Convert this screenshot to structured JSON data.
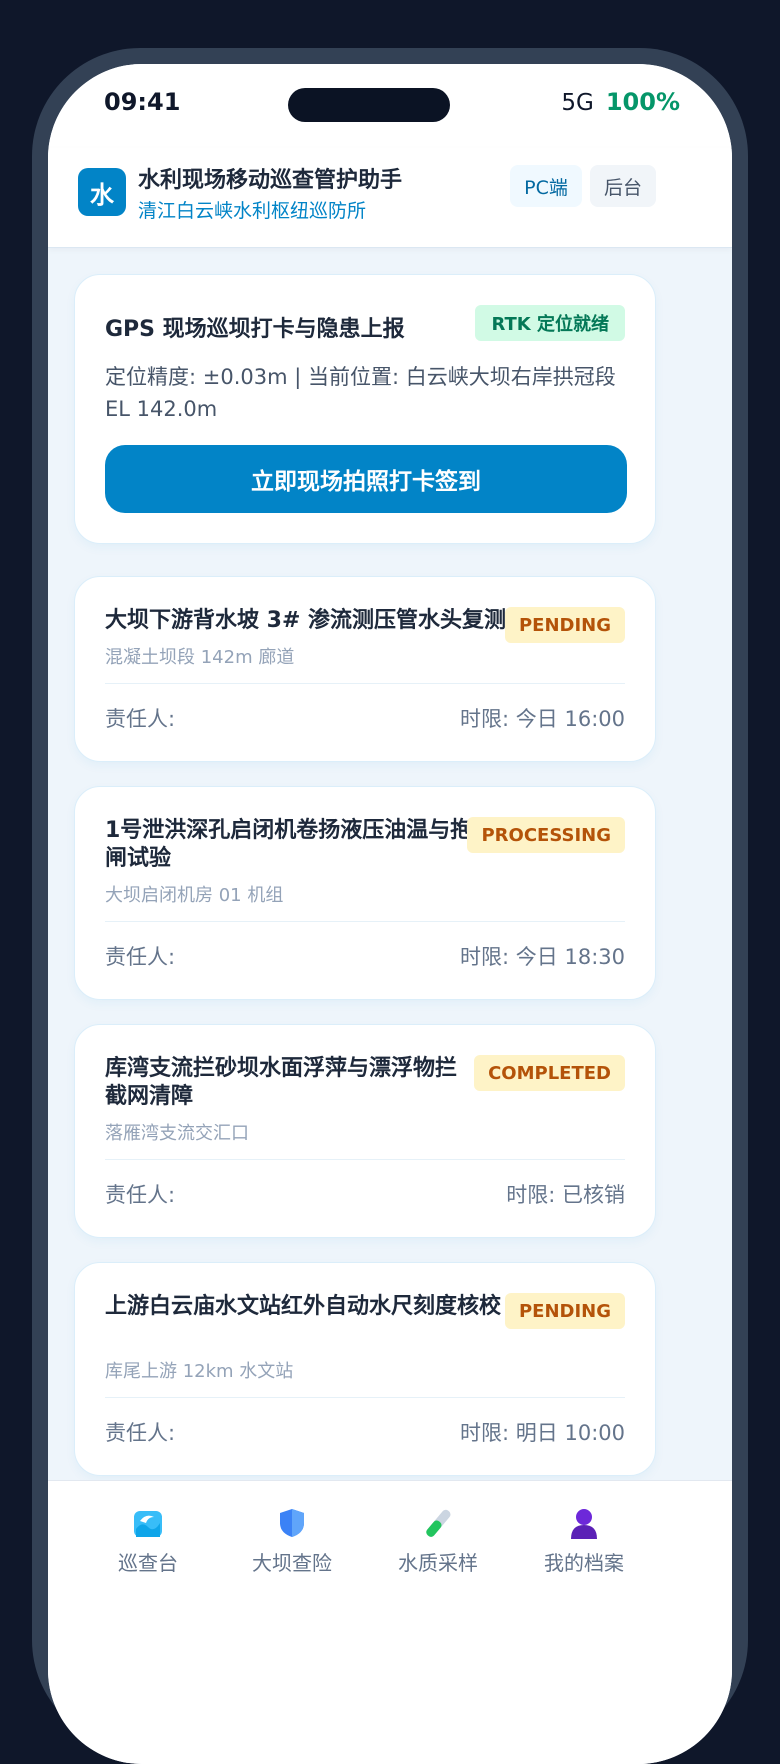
{
  "status_bar": {
    "time": "09:41",
    "signal": "5G",
    "battery": "100%"
  },
  "header": {
    "logo_char": "水",
    "title": "水利现场移动巡查管护助手",
    "subtitle": "清江白云峡水利枢纽巡防所",
    "btn_pc": "PC端",
    "btn_admin": "后台"
  },
  "gps_card": {
    "title": "GPS 现场巡坝打卡与隐患上报",
    "badge": "RTK 定位就绪",
    "description": "定位精度: ±0.03m | 当前位置: 白云峡大坝右岸拱冠段 EL 142.0m",
    "button_label": "立即现场拍照打卡签到"
  },
  "tasks": [
    {
      "title": "大坝下游背水坡 3# 渗流测压管水头复测",
      "location": "混凝土坝段 142m 廊道",
      "status": "PENDING",
      "owner": "责任人:",
      "deadline": "时限: 今日 16:00"
    },
    {
      "title": "1号泄洪深孔启闭机卷扬液压油温与抱闸试验",
      "location": "大坝启闭机房 01 机组",
      "status": "PROCESSING",
      "owner": "责任人:",
      "deadline": "时限: 今日 18:30"
    },
    {
      "title": "库湾支流拦砂坝水面浮萍与漂浮物拦截网清障",
      "location": "落雁湾支流交汇口",
      "status": "COMPLETED",
      "owner": "责任人:",
      "deadline": "时限: 已核销"
    },
    {
      "title": "上游白云庙水文站红外自动水尺刻度核校",
      "location": "库尾上游 12km 水文站",
      "status": "PENDING",
      "owner": "责任人:",
      "deadline": "时限: 明日 10:00"
    }
  ],
  "nav": [
    {
      "label": "巡查台",
      "icon": "wave-icon"
    },
    {
      "label": "大坝查险",
      "icon": "shield-icon"
    },
    {
      "label": "水质采样",
      "icon": "test-tube-icon"
    },
    {
      "label": "我的档案",
      "icon": "user-icon"
    }
  ],
  "colors": {
    "primary": "#0284c7",
    "success": "#059669",
    "warning_bg": "#fef3c7",
    "warning_text": "#b45309"
  }
}
